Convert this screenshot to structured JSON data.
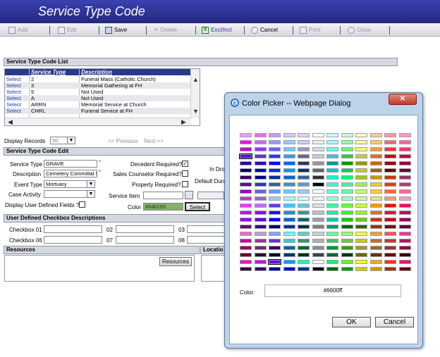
{
  "window": {
    "title": "Service Type Code"
  },
  "toolbar": {
    "add": "Add",
    "edit": "Edit",
    "save": "Save",
    "delete": "Delete",
    "exclincl": "Excl/Incl",
    "cancel": "Cancel",
    "print": "Print",
    "close": "Close"
  },
  "list_section": {
    "title": "Service Type Code List",
    "columns": [
      "Service Type",
      "Description"
    ],
    "rows": [
      {
        "select": "Select",
        "code": "2",
        "description": "Funeral Mass (Catholic Church)"
      },
      {
        "select": "Select",
        "code": "3",
        "description": "Memorial Gathering at FH"
      },
      {
        "select": "Select",
        "code": "5",
        "description": "Not Used"
      },
      {
        "select": "Select",
        "code": "A",
        "description": "Not Used"
      },
      {
        "select": "Select",
        "code": "ARRN",
        "description": "Memorial Service at Church"
      },
      {
        "select": "Select",
        "code": "CHRL",
        "description": "Funeral Service at FH"
      }
    ],
    "display_records_label": "Display Records",
    "display_records_value": "50",
    "prev": "<< Previous",
    "next": "Next >>"
  },
  "edit_section": {
    "title": "Service Type Code Edit",
    "service_type_label": "Service Type",
    "service_type_value": "GRAVE",
    "description_label": "Description",
    "description_value": "Cemetery Committal S",
    "event_type_label": "Event Type",
    "event_type_value": "Mortuary",
    "case_activity_label": "Case Activity",
    "case_activity_value": "",
    "user_defined_label": "Display User Defined Fields ?",
    "decedent_required_label": "Decedent Required?",
    "sales_counselor_label": "Sales Counselor Required?",
    "property_required_label": "Property Required?",
    "service_item_label": "Service Item",
    "color_label": "Color",
    "color_value": "#84b165",
    "select_button": "Select",
    "in_dro_label": "In Dro",
    "default_dur_label": "Default Dura"
  },
  "checkbox_section": {
    "title": "User Defined Checkbox Descriptions",
    "labels": [
      "Checkbox 01",
      "02",
      "03",
      "Checkbox 06",
      "07",
      "08"
    ]
  },
  "resources": {
    "title": "Resources",
    "button": "Resources"
  },
  "location": {
    "title": "Locatio"
  },
  "dialog": {
    "title": "Color Picker -- Webpage Dialog",
    "color_label": "Color:",
    "color_value": "#6600ff",
    "ok": "OK",
    "cancel": "Cancel",
    "swatches": [
      [
        "#ff99ff",
        "#ff66ff",
        "#cc99ff",
        "#ccccff",
        "#e6ccff",
        "#ffffff",
        "#ccffff",
        "#ccffcc",
        "#ffffcc",
        "#ffcc99",
        "#ff9999",
        "#ff99cc"
      ],
      [
        "#ff00ff",
        "#cc66ff",
        "#9999ff",
        "#99ccff",
        "#ccccff",
        "#eeeeee",
        "#99ffff",
        "#99ff99",
        "#ffff99",
        "#ffcc66",
        "#ff6666",
        "#ff6699"
      ],
      [
        "#cc00cc",
        "#9933ff",
        "#6666ff",
        "#66ccff",
        "#9999cc",
        "#dddddd",
        "#66ffff",
        "#66ff66",
        "#ffff66",
        "#ff9933",
        "#ff3333",
        "#ff3366"
      ],
      [
        "#6600ff",
        "#6633cc",
        "#3333ff",
        "#3399ff",
        "#666699",
        "#cccccc",
        "#33cccc",
        "#33cc33",
        "#cccc33",
        "#ff6600",
        "#cc0000",
        "#cc0033"
      ],
      [
        "#330099",
        "#3300cc",
        "#0000ff",
        "#0066ff",
        "#333366",
        "#999999",
        "#009999",
        "#009900",
        "#999900",
        "#cc6600",
        "#990000",
        "#990033"
      ],
      [
        "#000066",
        "#0000cc",
        "#0033cc",
        "#0099ff",
        "#003366",
        "#666666",
        "#00cccc",
        "#00cc66",
        "#cccc00",
        "#996600",
        "#660000",
        "#660033"
      ],
      [
        "#330066",
        "#000099",
        "#003399",
        "#0066cc",
        "#336699",
        "#333333",
        "#00ffcc",
        "#00ff66",
        "#99cc00",
        "#cc9900",
        "#cc3300",
        "#993366"
      ],
      [
        "#660099",
        "#3333cc",
        "#336699",
        "#3399cc",
        "#6699cc",
        "#000000",
        "#33ffcc",
        "#33ff99",
        "#99ff33",
        "#ffcc00",
        "#ff3300",
        "#cc3366"
      ],
      [
        "#9900cc",
        "#6666cc",
        "#6699ff",
        "#66ccff",
        "#99ccff",
        "#ffffff",
        "#66ffcc",
        "#66ff99",
        "#ccff66",
        "#ffcc33",
        "#ff6633",
        "#ff6699"
      ],
      [
        "#cc33cc",
        "#9966cc",
        "#99ccff",
        "#99ffff",
        "#ccffff",
        "#f2f2f2",
        "#99ffcc",
        "#99ffcc",
        "#ccff99",
        "#ffdd66",
        "#ff9966",
        "#ff99cc"
      ],
      [
        "#ff33ff",
        "#cc66ff",
        "#6633ff",
        "#33ccff",
        "#66cccc",
        "#e0e0e0",
        "#33ff99",
        "#66ff33",
        "#ccff33",
        "#ff9900",
        "#ff0000",
        "#ff0066"
      ],
      [
        "#cc00ff",
        "#9900ff",
        "#3300ff",
        "#0099cc",
        "#339999",
        "#c0c0c0",
        "#00ff99",
        "#33ff00",
        "#99ff00",
        "#ff6600",
        "#ff0033",
        "#cc0066"
      ],
      [
        "#9900ff",
        "#6600cc",
        "#0000ff",
        "#0066cc",
        "#006666",
        "#a0a0a0",
        "#00cc99",
        "#00cc00",
        "#66cc00",
        "#cc3300",
        "#cc0000",
        "#990066"
      ],
      [
        "#660066",
        "#330099",
        "#000066",
        "#003399",
        "#003333",
        "#808080",
        "#009966",
        "#006600",
        "#336600",
        "#993300",
        "#800000",
        "#660033"
      ],
      [
        "#ff66cc",
        "#cc99cc",
        "#9999ff",
        "#66ffff",
        "#66cccc",
        "#d0d0d0",
        "#66ff99",
        "#99ff66",
        "#ffff33",
        "#ff9933",
        "#ff5050",
        "#ff3399"
      ],
      [
        "#cc0099",
        "#993399",
        "#6633cc",
        "#33cccc",
        "#339966",
        "#b0b0b0",
        "#33cc66",
        "#66cc33",
        "#cccc00",
        "#cc6633",
        "#cc3333",
        "#cc0066"
      ],
      [
        "#990066",
        "#663366",
        "#330066",
        "#006699",
        "#006633",
        "#909090",
        "#009933",
        "#339900",
        "#999933",
        "#996633",
        "#993333",
        "#990033"
      ],
      [
        "#660033",
        "#330033",
        "#000033",
        "#003366",
        "#003300",
        "#404040",
        "#006633",
        "#003300",
        "#666600",
        "#663300",
        "#660000",
        "#330000"
      ],
      [
        "#ff00cc",
        "#cc00ff",
        "#6600ff",
        "#0099ff",
        "#00ffcc",
        "#ffffff",
        "#00ff66",
        "#66ff00",
        "#ffff00",
        "#ffaa00",
        "#ff3300",
        "#ff0066"
      ],
      [
        "#330033",
        "#330066",
        "#000099",
        "#0000cc",
        "#003399",
        "#000000",
        "#006600",
        "#009900",
        "#cccc00",
        "#cc9900",
        "#993300",
        "#660000"
      ]
    ]
  }
}
